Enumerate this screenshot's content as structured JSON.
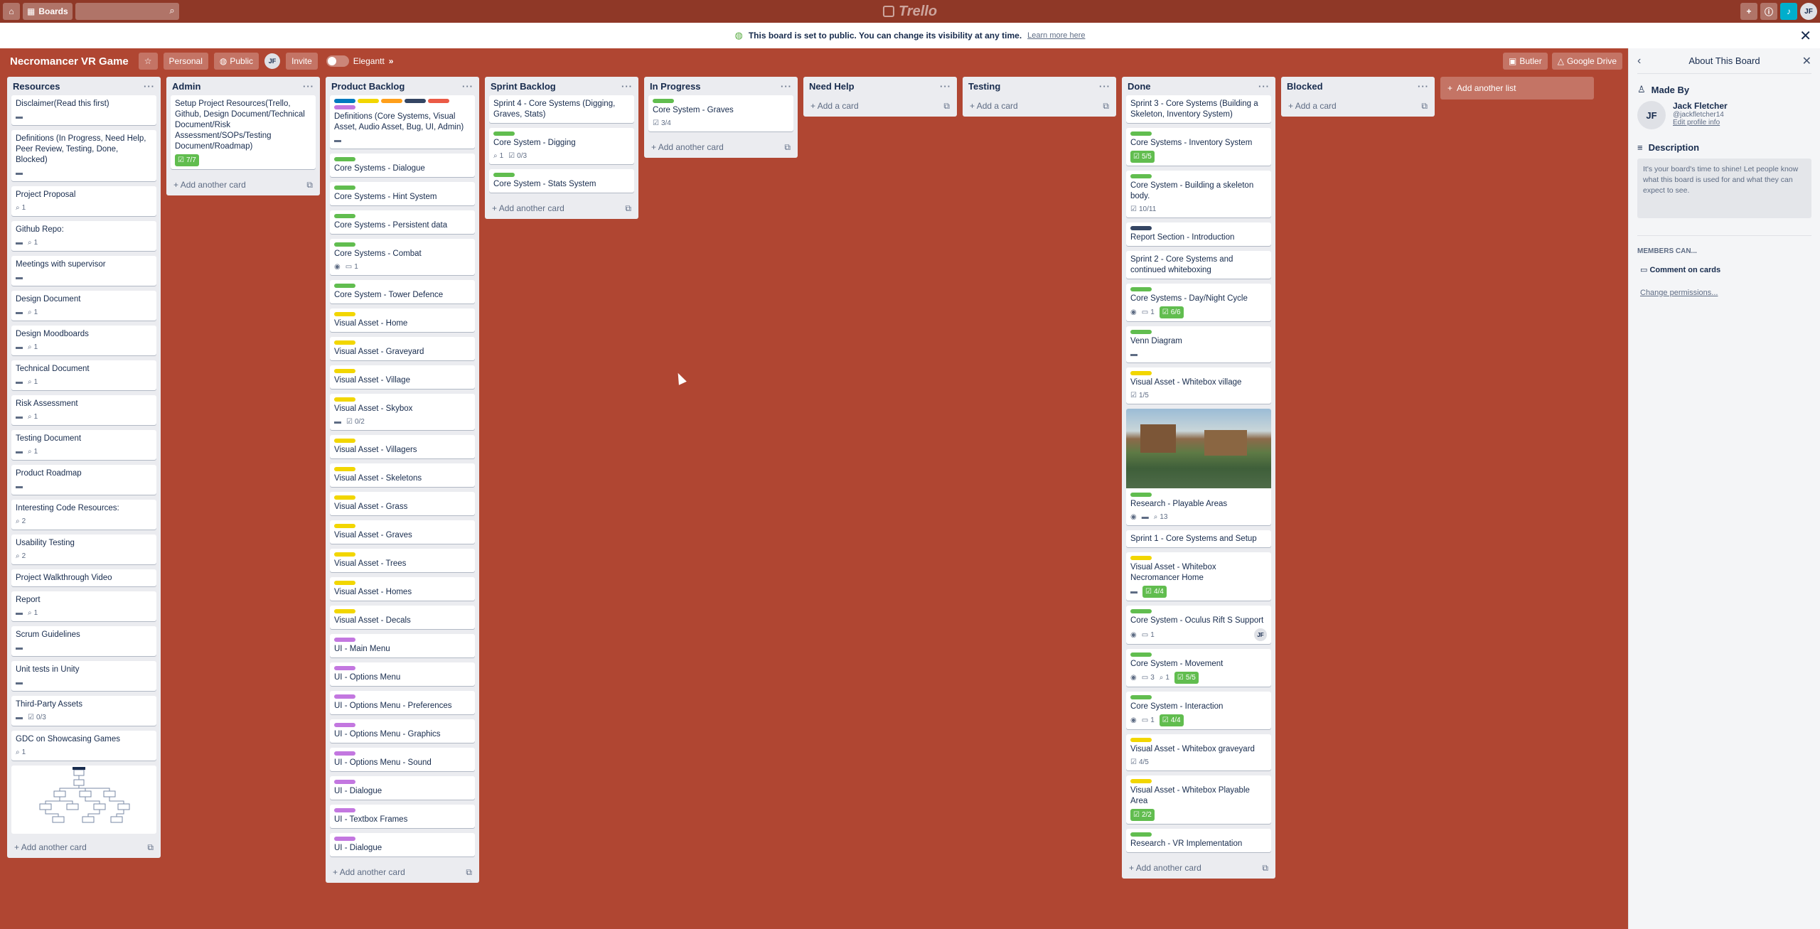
{
  "topbar": {
    "boards_label": "Boards",
    "logo": "Trello",
    "user_initials": "JF"
  },
  "banner": {
    "text": "This board is set to public. You can change its visibility at any time.",
    "link": "Learn more here"
  },
  "board": {
    "title": "Necromancer VR Game",
    "team": "Personal",
    "visibility": "Public",
    "invite": "Invite",
    "powerup": "Elegantt",
    "butler": "Butler",
    "gdrive": "Google Drive"
  },
  "colors": {
    "green": "#61bd4f",
    "yellow": "#f2d600",
    "orange": "#ff9f1a",
    "red": "#eb5a46",
    "purple": "#c377e0",
    "navy": "#344563",
    "blue": "#0079bf"
  },
  "lists": [
    {
      "title": "Resources",
      "add": "Add another card",
      "cards": [
        {
          "title": "Disclaimer(Read this first)",
          "desc": true
        },
        {
          "title": "Definitions (In Progress, Need Help, Peer Review, Testing, Done, Blocked)",
          "desc": true
        },
        {
          "title": "Project Proposal",
          "attach": "1"
        },
        {
          "title": "Github Repo:",
          "desc": true,
          "attach": "1"
        },
        {
          "title": "Meetings with supervisor",
          "desc": true
        },
        {
          "title": "Design Document",
          "desc": true,
          "attach": "1"
        },
        {
          "title": "Design Moodboards",
          "desc": true,
          "attach": "1"
        },
        {
          "title": "Technical Document",
          "desc": true,
          "attach": "1"
        },
        {
          "title": "Risk Assessment",
          "desc": true,
          "attach": "1"
        },
        {
          "title": "Testing Document",
          "desc": true,
          "attach": "1"
        },
        {
          "title": "Product Roadmap",
          "desc": true
        },
        {
          "title": "Interesting Code Resources:",
          "attach": "2"
        },
        {
          "title": "Usability Testing",
          "attach": "2"
        },
        {
          "title": "Project Walkthrough Video"
        },
        {
          "title": "Report",
          "desc": true,
          "attach": "1"
        },
        {
          "title": "Scrum Guidelines",
          "desc": true
        },
        {
          "title": "Unit tests in Unity",
          "desc": true
        },
        {
          "title": "Third-Party Assets",
          "desc": true,
          "check": "0/3"
        },
        {
          "title": "GDC on Showcasing Games",
          "attach": "1"
        },
        {
          "title": "",
          "diagram": true
        }
      ]
    },
    {
      "title": "Admin",
      "add": "Add another card",
      "cards": [
        {
          "title": "Setup Project Resources(Trello, Github, Design Document/Technical Document/Risk Assessment/SOPs/Testing Document/Roadmap)",
          "checkdone": "7/7"
        }
      ]
    },
    {
      "title": "Product Backlog",
      "add": "Add another card",
      "cards": [
        {
          "title": "Definitions (Core Systems, Visual Asset, Audio Asset, Bug, UI, Admin)",
          "labels": [
            "#0079bf",
            "#f2d600",
            "#ff9f1a",
            "#344563",
            "#eb5a46",
            "#c377e0"
          ],
          "desc": true
        },
        {
          "title": "Core Systems - Dialogue",
          "labels": [
            "#61bd4f"
          ]
        },
        {
          "title": "Core Systems - Hint System",
          "labels": [
            "#61bd4f"
          ]
        },
        {
          "title": "Core Systems - Persistent data",
          "labels": [
            "#61bd4f"
          ]
        },
        {
          "title": "Core Systems - Combat",
          "labels": [
            "#61bd4f"
          ],
          "watch": true,
          "comments": "1"
        },
        {
          "title": "Core System - Tower Defence",
          "labels": [
            "#61bd4f"
          ]
        },
        {
          "title": "Visual Asset - Home",
          "labels": [
            "#f2d600"
          ]
        },
        {
          "title": "Visual Asset - Graveyard",
          "labels": [
            "#f2d600"
          ]
        },
        {
          "title": "Visual Asset - Village",
          "labels": [
            "#f2d600"
          ]
        },
        {
          "title": "Visual Asset - Skybox",
          "labels": [
            "#f2d600"
          ],
          "desc": true,
          "check": "0/2"
        },
        {
          "title": "Visual Asset - Villagers",
          "labels": [
            "#f2d600"
          ]
        },
        {
          "title": "Visual Asset - Skeletons",
          "labels": [
            "#f2d600"
          ]
        },
        {
          "title": "Visual Asset - Grass",
          "labels": [
            "#f2d600"
          ]
        },
        {
          "title": "Visual Asset - Graves",
          "labels": [
            "#f2d600"
          ]
        },
        {
          "title": "Visual Asset - Trees",
          "labels": [
            "#f2d600"
          ]
        },
        {
          "title": "Visual Asset - Homes",
          "labels": [
            "#f2d600"
          ]
        },
        {
          "title": "Visual Asset - Decals",
          "labels": [
            "#f2d600"
          ]
        },
        {
          "title": "UI - Main Menu",
          "labels": [
            "#c377e0"
          ]
        },
        {
          "title": "UI - Options Menu",
          "labels": [
            "#c377e0"
          ]
        },
        {
          "title": "UI - Options Menu - Preferences",
          "labels": [
            "#c377e0"
          ]
        },
        {
          "title": "UI - Options Menu - Graphics",
          "labels": [
            "#c377e0"
          ]
        },
        {
          "title": "UI - Options Menu - Sound",
          "labels": [
            "#c377e0"
          ]
        },
        {
          "title": "UI - Dialogue",
          "labels": [
            "#c377e0"
          ]
        },
        {
          "title": "UI - Textbox Frames",
          "labels": [
            "#c377e0"
          ]
        },
        {
          "title": "UI - Dialogue",
          "labels": [
            "#c377e0"
          ]
        }
      ]
    },
    {
      "title": "Sprint Backlog",
      "add": "Add another card",
      "cards": [
        {
          "title": "Sprint 4 - Core Systems (Digging, Graves, Stats)"
        },
        {
          "title": "Core System - Digging",
          "labels": [
            "#61bd4f"
          ],
          "attach": "1",
          "check": "0/3"
        },
        {
          "title": "Core System - Stats System",
          "labels": [
            "#61bd4f"
          ]
        }
      ]
    },
    {
      "title": "In Progress",
      "add": "Add another card",
      "cards": [
        {
          "title": "Core System - Graves",
          "labels": [
            "#61bd4f"
          ],
          "check": "3/4"
        }
      ]
    },
    {
      "title": "Need Help",
      "add": "Add a card",
      "cards": []
    },
    {
      "title": "Testing",
      "add": "Add a card",
      "cards": []
    },
    {
      "title": "Done",
      "add": "Add another card",
      "cards": [
        {
          "title": "Sprint 3 - Core Systems (Building a Skeleton, Inventory System)"
        },
        {
          "title": "Core Systems - Inventory System",
          "labels": [
            "#61bd4f"
          ],
          "checkdone": "5/5"
        },
        {
          "title": "Core System - Building a skeleton body.",
          "labels": [
            "#61bd4f"
          ],
          "check": "10/11"
        },
        {
          "title": "Report Section - Introduction",
          "labels": [
            "#344563"
          ]
        },
        {
          "title": "Sprint 2 - Core Systems and continued whiteboxing"
        },
        {
          "title": "Core Systems - Day/Night Cycle",
          "labels": [
            "#61bd4f"
          ],
          "watch": true,
          "comments": "1",
          "checkdone": "6/6"
        },
        {
          "title": "Venn Diagram",
          "labels": [
            "#61bd4f"
          ],
          "desc": true
        },
        {
          "title": "Visual Asset - Whitebox village",
          "labels": [
            "#f2d600"
          ],
          "check": "1/5"
        },
        {
          "title": "Research - Playable Areas",
          "labels": [
            "#61bd4f"
          ],
          "cover": true,
          "watch": true,
          "desc": true,
          "attach": "13"
        },
        {
          "title": "Sprint 1 - Core Systems and Setup"
        },
        {
          "title": "Visual Asset - Whitebox Necromancer Home",
          "labels": [
            "#f2d600"
          ],
          "desc": true,
          "checkdone": "4/4"
        },
        {
          "title": "Core System - Oculus Rift S Support",
          "labels": [
            "#61bd4f"
          ],
          "watch": true,
          "comments": "1",
          "member": "JF"
        },
        {
          "title": "Core System - Movement",
          "labels": [
            "#61bd4f"
          ],
          "watch": true,
          "comments": "3",
          "attach": "1",
          "checkdone": "5/5"
        },
        {
          "title": "Core System - Interaction",
          "labels": [
            "#61bd4f"
          ],
          "watch": true,
          "comments": "1",
          "checkdone": "4/4"
        },
        {
          "title": "Visual Asset - Whitebox graveyard",
          "labels": [
            "#f2d600"
          ],
          "check": "4/5"
        },
        {
          "title": "Visual Asset - Whitebox Playable Area",
          "labels": [
            "#f2d600"
          ],
          "checkdone": "2/2"
        },
        {
          "title": "Research - VR Implementation",
          "labels": [
            "#61bd4f"
          ]
        }
      ]
    },
    {
      "title": "Blocked",
      "add": "Add a card",
      "cards": []
    }
  ],
  "add_list": "Add another list",
  "panel": {
    "title": "About This Board",
    "made_by": "Made By",
    "name": "Jack Fletcher",
    "handle": "@jackfletcher14",
    "edit": "Edit profile info",
    "initials": "JF",
    "description_label": "Description",
    "description": "It's your board's time to shine! Let people know what this board is used for and what they can expect to see.",
    "members_can": "MEMBERS CAN...",
    "comment": "Comment on cards",
    "change": "Change permissions..."
  }
}
